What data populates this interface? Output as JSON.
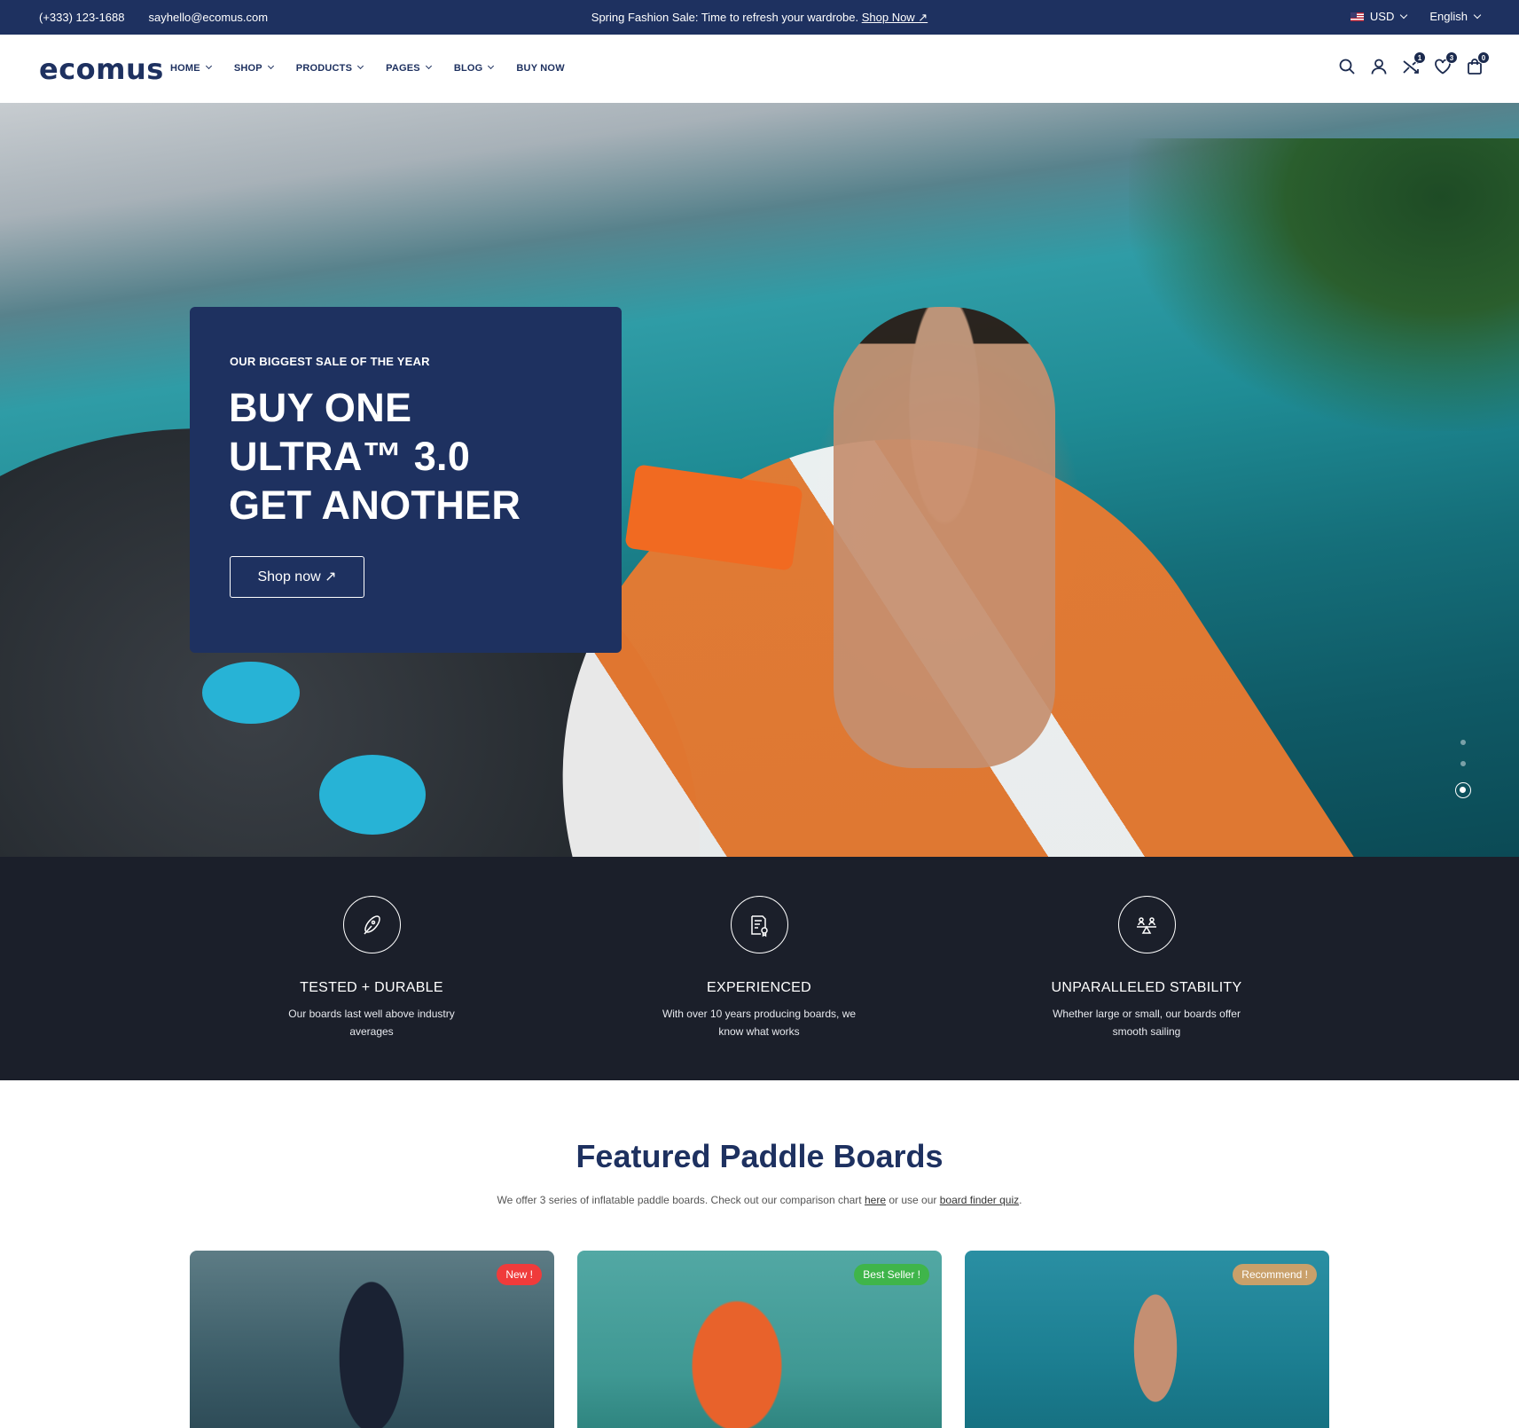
{
  "topbar": {
    "phone": "(+333) 123-1688",
    "email": "sayhello@ecomus.com",
    "announcement": "Spring Fashion Sale: Time to refresh your wardrobe.",
    "announcement_link": "Shop Now ↗",
    "currency": "USD",
    "language": "English"
  },
  "header": {
    "logo": "ecomus",
    "nav": [
      "HOME",
      "SHOP",
      "PRODUCTS",
      "PAGES",
      "BLOG",
      "BUY NOW"
    ],
    "icons": [
      "search-icon",
      "account-icon",
      "compare-icon",
      "wishlist-icon",
      "cart-icon"
    ],
    "compare_count": "1",
    "wishlist_count": "3",
    "cart_count": "0"
  },
  "hero": {
    "eyebrow": "OUR BIGGEST SALE OF THE YEAR",
    "headline": "BUY ONE\nULTRA™ 3.0\nGET ANOTHER",
    "button": "Shop now ↗",
    "slides": 3,
    "active_slide": 3
  },
  "features": [
    {
      "icon": "paddle-board-icon",
      "title": "TESTED + DURABLE",
      "text": "Our boards last well above industry averages"
    },
    {
      "icon": "certificate-icon",
      "title": "EXPERIENCED",
      "text": "With over 10 years producing boards, we know what works"
    },
    {
      "icon": "balance-icon",
      "title": "UNPARALLELED STABILITY",
      "text": "Whether large or small, our boards offer smooth sailing"
    }
  ],
  "featured": {
    "title": "Featured Paddle Boards",
    "subtitle_before": "We offer 3 series of inflatable paddle boards. Check out our comparison chart",
    "link_here": "here",
    "subtitle_middle": "or use our",
    "link_quiz": "board finder quiz",
    "subtitle_end": ".",
    "cards": [
      {
        "tag": "New !",
        "tag_color": "#f03b3b"
      },
      {
        "tag": "Best Seller !",
        "tag_color": "#3fb54a"
      },
      {
        "tag": "Recommend !",
        "tag_color": "#c9a06a"
      }
    ]
  },
  "colors": {
    "navy": "#1e3160",
    "dark": "#1b1f2a"
  }
}
